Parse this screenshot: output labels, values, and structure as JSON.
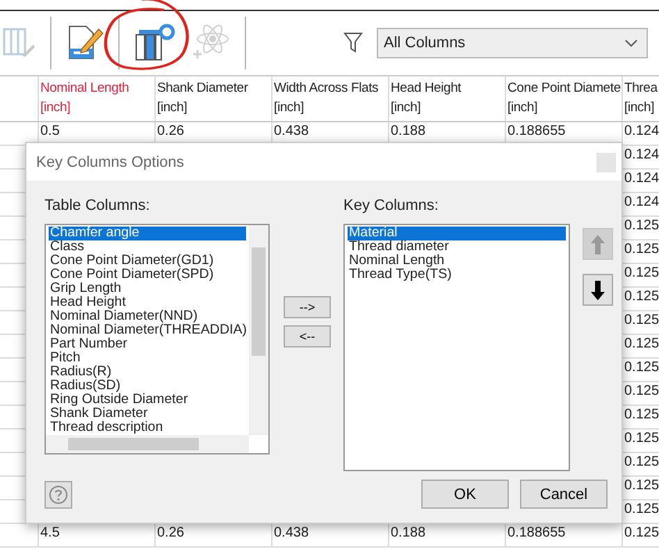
{
  "toolbar": {
    "filter": {
      "value": "All Columns"
    },
    "tools": [
      {
        "kind": "table-edit",
        "disabled": true
      },
      {
        "kind": "sep"
      },
      {
        "kind": "doc-edit",
        "disabled": false
      },
      {
        "kind": "sep"
      },
      {
        "kind": "key-columns",
        "disabled": false
      },
      {
        "kind": "atom",
        "disabled": true
      },
      {
        "kind": "sep"
      }
    ]
  },
  "table": {
    "columns": [
      {
        "name": "Nominal Length",
        "unit": "[inch]",
        "highlighted": true
      },
      {
        "name": "Shank Diameter",
        "unit": "[inch]",
        "highlighted": false
      },
      {
        "name": "Width Across Flats",
        "unit": "[inch]",
        "highlighted": false
      },
      {
        "name": "Head Height",
        "unit": "[inch]",
        "highlighted": false
      },
      {
        "name": "Cone Point Diamete",
        "unit": "[inch]",
        "highlighted": false
      },
      {
        "name": "Threa",
        "unit": "[inch]",
        "highlighted": false
      }
    ],
    "rows": [
      {
        "cells": [
          "0.5",
          "0.26",
          "0.438",
          "0.188",
          "0.188655",
          "0.124"
        ]
      },
      {
        "cells": [
          "0.124"
        ]
      },
      {
        "cells": [
          "0.124"
        ]
      },
      {
        "cells": [
          "0.124"
        ]
      },
      {
        "cells": [
          "0.125"
        ]
      },
      {
        "cells": [
          "0.125"
        ]
      },
      {
        "cells": [
          "0.125"
        ]
      },
      {
        "cells": [
          "0.125"
        ]
      },
      {
        "cells": [
          "0.125"
        ]
      },
      {
        "cells": [
          "0.125"
        ]
      },
      {
        "cells": [
          "0.125"
        ]
      },
      {
        "cells": [
          "0.125"
        ]
      },
      {
        "cells": [
          "0.125"
        ]
      },
      {
        "cells": [
          "0.125"
        ]
      },
      {
        "cells": [
          "0.125"
        ]
      },
      {
        "cells": [
          "0.125"
        ]
      },
      {
        "cells": [
          "0.125"
        ]
      },
      {
        "cells": [
          "4.5",
          "0.26",
          "0.438",
          "0.188",
          "0.188655",
          "0.125"
        ]
      }
    ]
  },
  "dialog": {
    "title": "Key Columns Options",
    "table_columns": {
      "label": "Table Columns:",
      "items": [
        {
          "text": "Chamfer angle",
          "selected": true
        },
        {
          "text": "Class",
          "selected": false
        },
        {
          "text": "Cone Point Diameter(GD1)",
          "selected": false
        },
        {
          "text": "Cone Point Diameter(SPD)",
          "selected": false
        },
        {
          "text": "Grip Length",
          "selected": false
        },
        {
          "text": "Head Height",
          "selected": false
        },
        {
          "text": "Nominal Diameter(NND)",
          "selected": false
        },
        {
          "text": "Nominal Diameter(THREADDIA)",
          "selected": false
        },
        {
          "text": "Part Number",
          "selected": false
        },
        {
          "text": "Pitch",
          "selected": false
        },
        {
          "text": "Radius(R)",
          "selected": false
        },
        {
          "text": "Radius(SD)",
          "selected": false
        },
        {
          "text": "Ring Outside Diameter",
          "selected": false
        },
        {
          "text": "Shank Diameter",
          "selected": false
        },
        {
          "text": "Thread description",
          "selected": false
        }
      ]
    },
    "move_buttons": [
      "-->",
      "<--"
    ],
    "key_columns": {
      "label": "Key Columns:",
      "items": [
        {
          "text": "Material",
          "selected": true
        },
        {
          "text": "Thread diameter",
          "selected": false
        },
        {
          "text": "Nominal Length",
          "selected": false
        },
        {
          "text": "Thread Type(TS)",
          "selected": false
        }
      ]
    },
    "move_up": {
      "disabled": true
    },
    "move_down": {
      "disabled": false
    },
    "buttons": [
      "OK",
      "Cancel"
    ]
  }
}
